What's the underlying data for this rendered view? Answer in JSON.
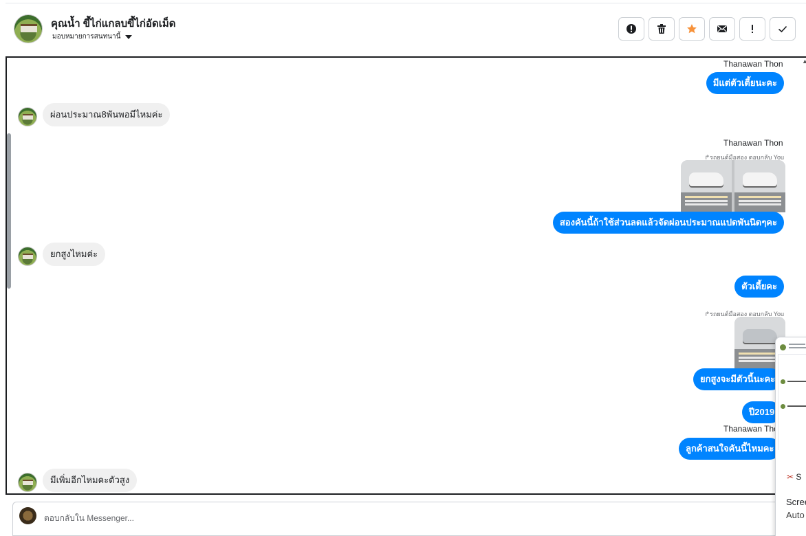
{
  "header": {
    "title": "คุณน้ำ ขี้ไก่แกลบขี้ไก่อัดเม็ด",
    "assign_label": "มอบหมายการสนทนานี้"
  },
  "toolbar": {
    "buttons": [
      {
        "name": "spam-button",
        "icon": "exclamation-circle-icon"
      },
      {
        "name": "delete-button",
        "icon": "trash-icon"
      },
      {
        "name": "star-button",
        "icon": "star-icon"
      },
      {
        "name": "mark-unread-button",
        "icon": "envelope-icon"
      },
      {
        "name": "follow-up-button",
        "icon": "exclamation-icon"
      },
      {
        "name": "done-button",
        "icon": "check-icon"
      }
    ],
    "star_color": "#f7923a"
  },
  "messages": {
    "m1_sender": "Thanawan Thon",
    "m1_text": "มีแต่ตัวเตี้ยนะคะ",
    "m2_text": "ผ่อนประมาณ8พันพอมีไหมค่ะ",
    "m3_sender": "Thanawan Thon",
    "m3_reply_note": "รถยนต์มือสอง ตอบกลับ You",
    "m3_text": "สองคันนี้ถ้าใช้ส่วนลดแล้วจัดผ่อนประมาณแปดพันนิดๆคะ",
    "m4_text": "ยกสูงไหมค่ะ",
    "m5_text": "ตัวเตี้ยคะ",
    "m6_reply_note": "รถยนต์มือสอง ตอบกลับ You",
    "m6_text": "ยกสูงจะมีตัวนี้นะคะ",
    "m7_text": "ปี2019",
    "m8_sender": "Thanawan Thon",
    "m8_text": "ลูกค้าสนใจคันนี้ไหมคะ",
    "m9_text": "มีเพิ่มอีกไหมคะตัวสูง"
  },
  "composer": {
    "placeholder": "ตอบกลับใน Messenger..."
  },
  "popup": {
    "snip_label": "S",
    "line1": "Scree",
    "line2": "Auto"
  },
  "colors": {
    "outgoing_bubble": "#0084ff",
    "incoming_bubble": "#f0f0f0"
  }
}
